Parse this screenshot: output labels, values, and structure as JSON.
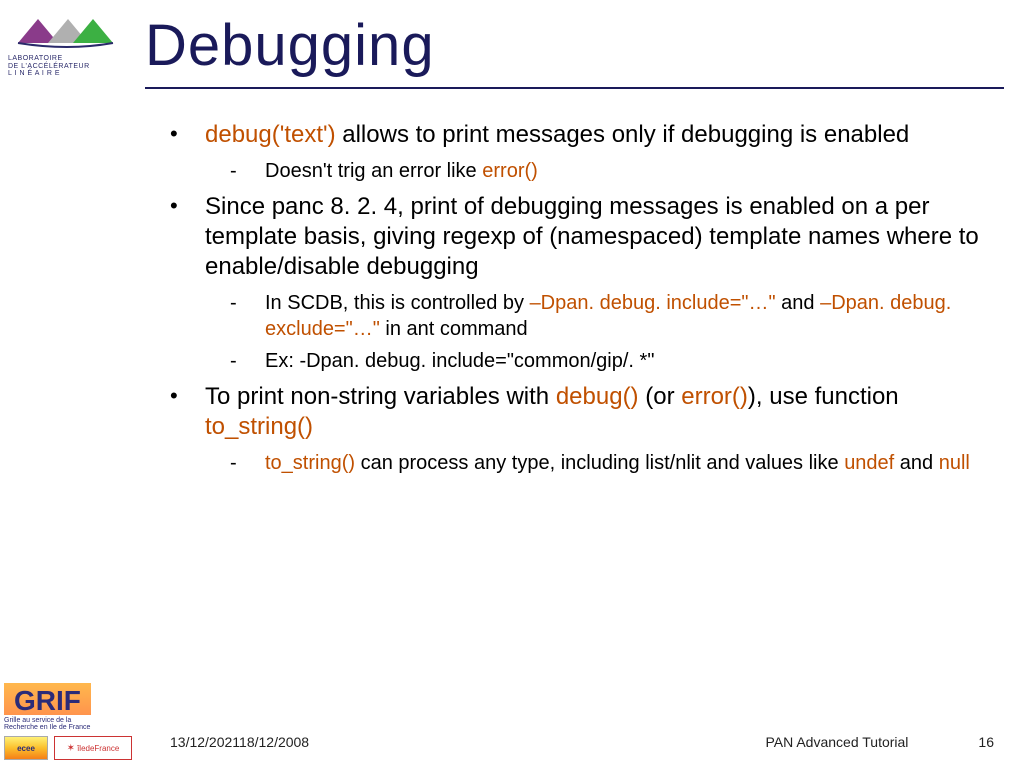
{
  "logo": {
    "sub_line1": "LABORATOIRE",
    "sub_line2": "DE L'ACCÉLÉRATEUR",
    "sub_line3": "L I N É A I R E"
  },
  "title": "Debugging",
  "bullets": [
    {
      "segments": [
        {
          "t": "debug('text')",
          "kw": true
        },
        {
          "t": " allows to print messages only if debugging is enabled"
        }
      ],
      "subs": [
        {
          "segments": [
            {
              "t": "Doesn't trig an error like "
            },
            {
              "t": "error()",
              "kw": true
            }
          ]
        }
      ]
    },
    {
      "segments": [
        {
          "t": "Since panc 8. 2. 4, print of debugging messages is enabled on a per template basis, giving regexp of (namespaced) template names where to enable/disable debugging"
        }
      ],
      "subs": [
        {
          "segments": [
            {
              "t": "In SCDB, this is controlled by "
            },
            {
              "t": "–Dpan. debug. include=\"…\"",
              "kw": true
            },
            {
              "t": " and "
            },
            {
              "t": "–Dpan. debug. exclude=\"…\"",
              "kw": true
            },
            {
              "t": " in ant command"
            }
          ]
        },
        {
          "segments": [
            {
              "t": "Ex: -Dpan. debug. include=\"common/gip/. *\""
            }
          ]
        }
      ]
    },
    {
      "segments": [
        {
          "t": "To print non-string variables with "
        },
        {
          "t": "debug()",
          "kw": true
        },
        {
          "t": " (or "
        },
        {
          "t": "error()",
          "kw": true
        },
        {
          "t": "), use function "
        },
        {
          "t": "to_string()",
          "kw": true
        }
      ],
      "subs": [
        {
          "segments": [
            {
              "t": "to_string()",
              "kw": true
            },
            {
              "t": " can process any type, including list/nlit and values like "
            },
            {
              "t": "undef",
              "kw": true
            },
            {
              "t": " and "
            },
            {
              "t": "null",
              "kw": true
            }
          ]
        }
      ]
    }
  ],
  "grif": {
    "label": "GRIF",
    "sub_line1": "Grille au service de la",
    "sub_line2": "Recherche en Ile de France"
  },
  "badges": {
    "ecee": "ecee",
    "region": "îledeFrance"
  },
  "footer": {
    "date": "13/12/202118/12/2008",
    "source": "PAN Advanced Tutorial",
    "page": "16"
  }
}
